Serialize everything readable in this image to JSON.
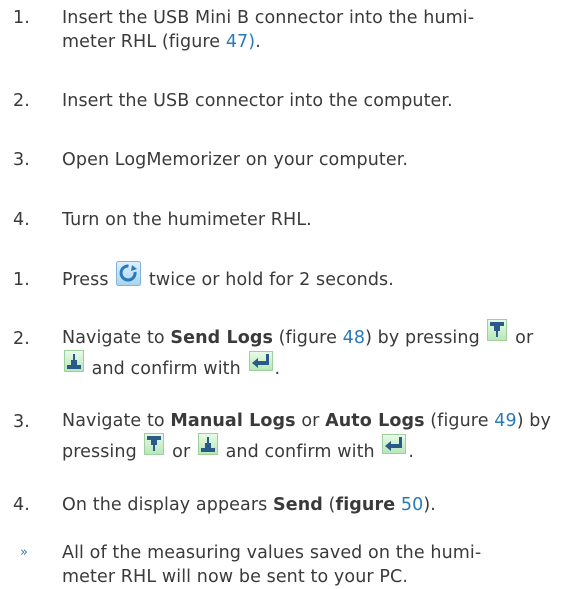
{
  "steps_a": [
    {
      "num": "1.",
      "line1": "Insert the USB Mini B connector into the humi-",
      "line2_pre": "meter RHL (figure ",
      "line2_link": "47)",
      "line2_post": "."
    },
    {
      "num": "2.",
      "text": "Insert the USB connector into the computer."
    },
    {
      "num": "3.",
      "text": "Open LogMemorizer on your computer."
    },
    {
      "num": "4.",
      "text": "Turn on the humimeter RHL."
    }
  ],
  "steps_b": [
    {
      "num": "1.",
      "pre": "Press",
      "post": "twice or hold for 2 seconds."
    },
    {
      "num": "2.",
      "t1": "Navigate to ",
      "bold1": "Send Logs",
      "t2": " (figure ",
      "link": "48",
      "t3": ") by pressing",
      "t4": "or",
      "t5": "and confirm with",
      "t6": "."
    },
    {
      "num": "3.",
      "t1": "Navigate to ",
      "bold1": "Manual Logs",
      "t2": " or ",
      "bold2": "Auto Logs",
      "t3": " (figure ",
      "link": "49",
      "t4": ") by",
      "t5": "pressing",
      "t6": "or",
      "t7": "and confirm with",
      "t8": "."
    },
    {
      "num": "4.",
      "t1": "On the display appears ",
      "bold1": "Send",
      "t2": " (",
      "bold2": "figure",
      "t3": " ",
      "link": "50",
      "t4": ")."
    }
  ],
  "result": {
    "bullet": "»",
    "line1": "All of the measuring values saved on the humi-",
    "line2": "meter RHL will now be sent to your PC."
  },
  "icons": {
    "power": "power-cycle-icon",
    "down": "down-arrow-icon",
    "up": "up-arrow-icon",
    "enter": "enter-icon"
  },
  "colors": {
    "link": "#2a7ab8",
    "text": "#3a3a3a"
  }
}
